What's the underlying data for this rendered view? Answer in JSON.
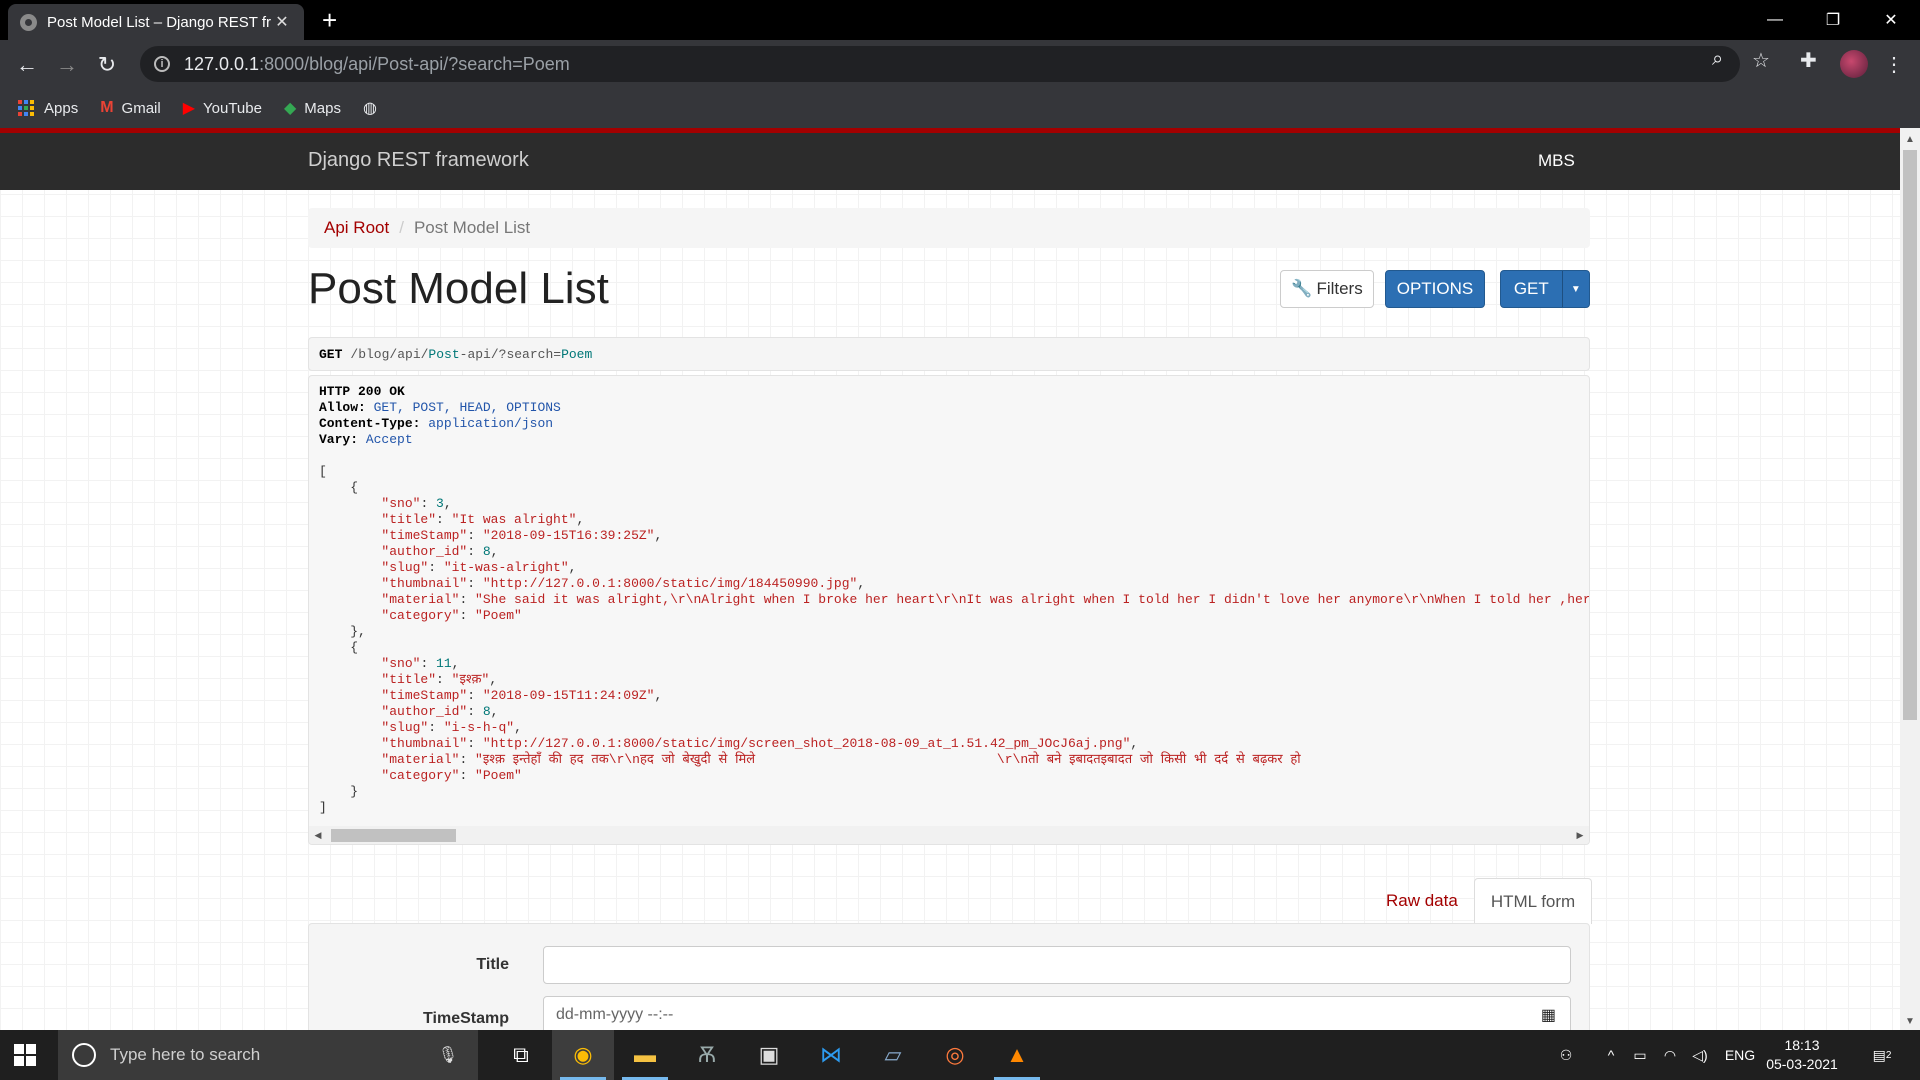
{
  "browser": {
    "tab_title": "Post Model List – Django REST fr",
    "url_host": "127.0.0.1",
    "url_rest": ":8000/blog/api/Post-api/?search=Poem",
    "bookmarks": [
      "Apps",
      "Gmail",
      "YouTube",
      "Maps"
    ]
  },
  "drf": {
    "brand": "Django REST framework",
    "user": "MBS",
    "breadcrumb_root": "Api Root",
    "breadcrumb_current": "Post Model List",
    "page_title": "Post Model List",
    "filters_label": "Filters",
    "options_label": "OPTIONS",
    "get_label": "GET"
  },
  "request": {
    "method": "GET",
    "path_a": "/blog/api/",
    "path_b": "Post",
    "path_c": "-api/?search=",
    "path_d": "Poem"
  },
  "response": {
    "status": "HTTP 200 OK",
    "allow": "GET, POST, HEAD, OPTIONS",
    "content_type": "application/json",
    "vary": "Accept",
    "items": [
      {
        "sno": "3",
        "title": "\"It was alright\"",
        "timeStamp": "\"2018-09-15T16:39:25Z\"",
        "author_id": "8",
        "slug": "\"it-was-alright\"",
        "thumbnail": "\"http://127.0.0.1:8000/static/img/184450990.jpg\"",
        "material": "\"She said it was alright,\\r\\nAlright when I broke her heart\\r\\nIt was alright when I told her I didn't love her anymore\\r\\nWhen I told her ,her eyes wer",
        "category": "\"Poem\""
      },
      {
        "sno": "11",
        "title": "\"इश्क़\"",
        "timeStamp": "\"2018-09-15T11:24:09Z\"",
        "author_id": "8",
        "slug": "\"i-s-h-q\"",
        "thumbnail": "\"http://127.0.0.1:8000/static/img/screen_shot_2018-08-09_at_1.51.42_pm_JOcJ6aj.png\"",
        "material": "\"इश्क़ इन्तेहाँ की हद तक\\r\\nहद जो बेखुदी से मिले                               \\r\\nतो बने इबादतइबादत जो किसी भी दर्द से बढ़कर हो",
        "category": "\"Poem\""
      }
    ]
  },
  "form": {
    "tab_raw": "Raw data",
    "tab_html": "HTML form",
    "label_title": "Title",
    "label_timestamp": "TimeStamp",
    "timestamp_placeholder": "dd-mm-yyyy --:--"
  },
  "taskbar": {
    "search_placeholder": "Type here to search",
    "lang": "ENG",
    "time": "18:13",
    "date": "05-03-2021",
    "notifications": "2"
  }
}
